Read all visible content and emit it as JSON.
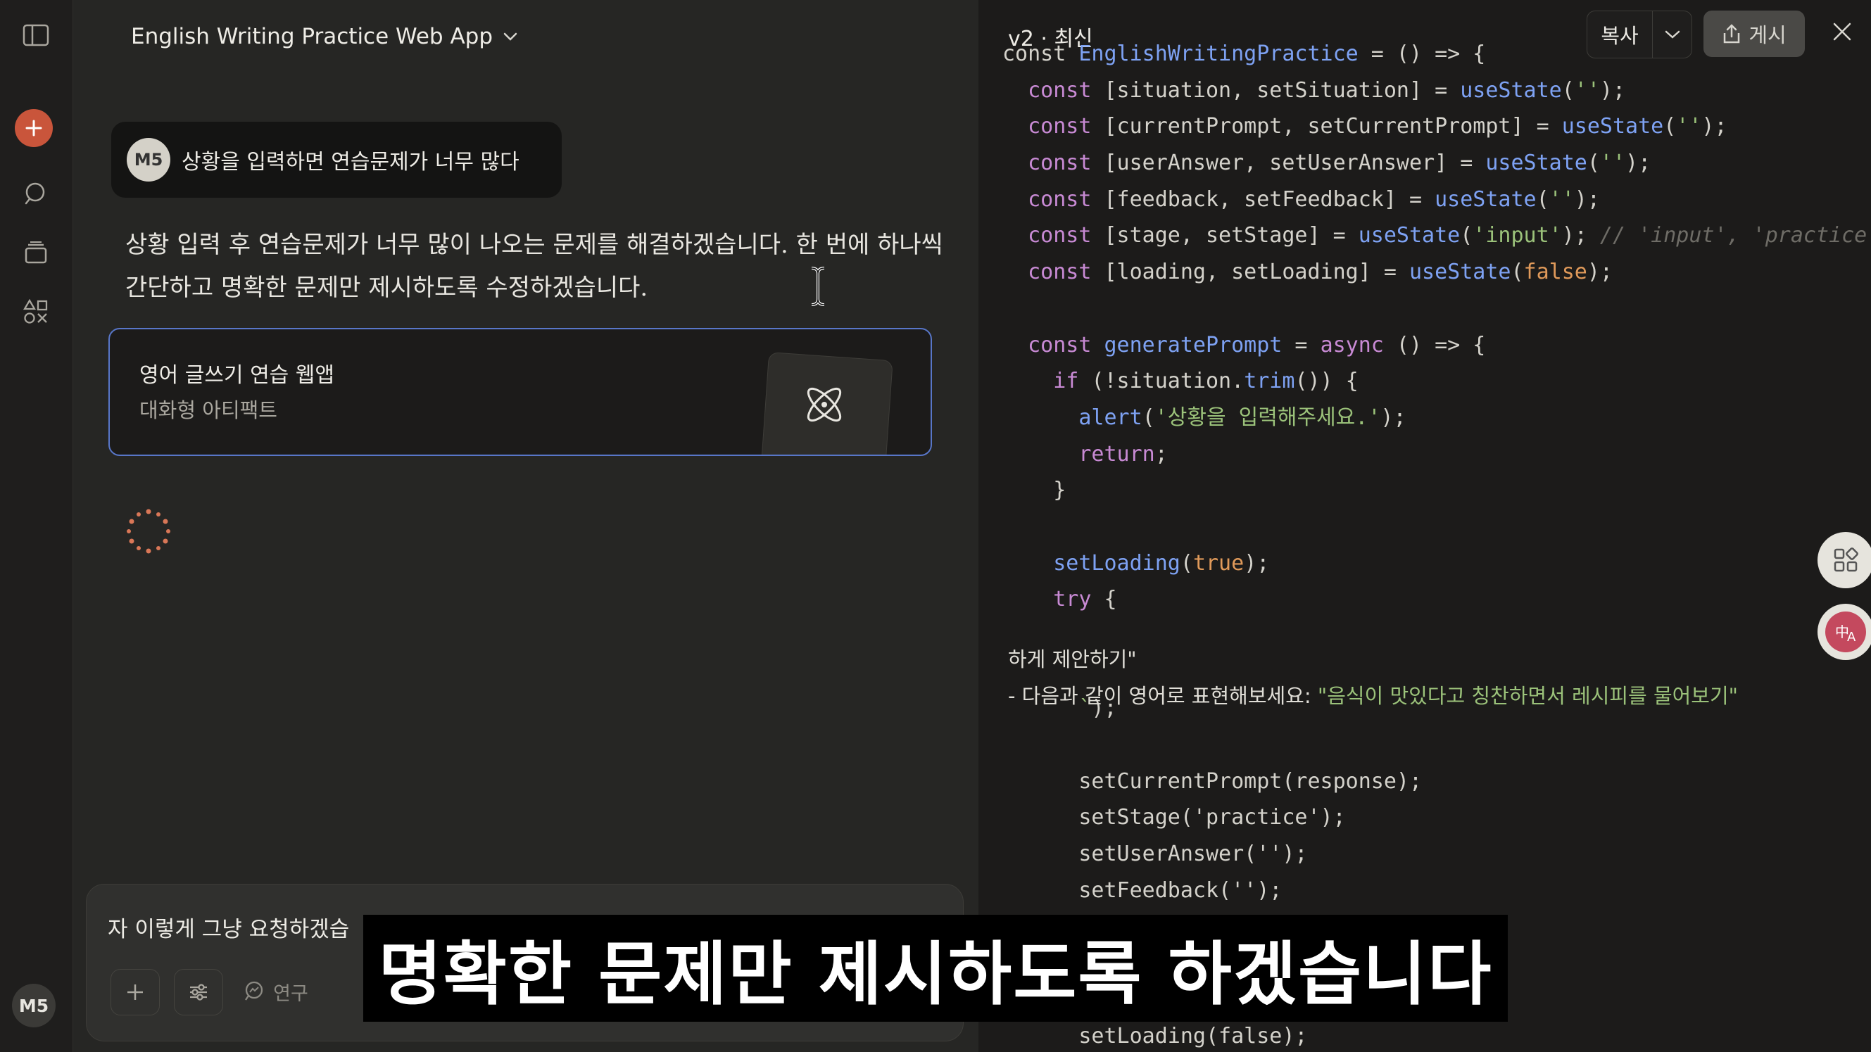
{
  "sidebar": {
    "avatar_initials": "M5",
    "accent_color": "#c9553b"
  },
  "chat": {
    "title": "English Writing Practice Web App",
    "user_message": {
      "avatar_initials": "M5",
      "text": "상황을 입력하면 연습문제가 너무 많다"
    },
    "assistant_text": "상황 입력 후 연습문제가 너무 많이 나오는 문제를 해결하겠습니다. 한 번에 하나씩 간단하고 명확한 문제만 제시하도록 수정하겠습니다.",
    "artifact_card": {
      "title": "영어 글쓰기 연습 웹앱",
      "subtitle": "대화형 아티팩트",
      "icon": "react-icon"
    },
    "composer": {
      "text": "자 이렇게 그냥 요청하겠습",
      "research_label": "연구"
    }
  },
  "artifact_panel": {
    "version_label": "v2 · 최신",
    "copy_label": "복사",
    "publish_label": "게시",
    "code_lines": [
      [
        [
          "v",
          "const "
        ],
        [
          "f",
          "EnglishWritingPractice"
        ],
        [
          "v",
          " = () => {"
        ]
      ],
      [
        [
          "k",
          "  const "
        ],
        [
          "v",
          "[situation, setSituation] = "
        ],
        [
          "f",
          "useState"
        ],
        [
          "v",
          "("
        ],
        [
          "s",
          "''"
        ],
        [
          "v",
          ");"
        ]
      ],
      [
        [
          "k",
          "  const "
        ],
        [
          "v",
          "[currentPrompt, setCurrentPrompt] = "
        ],
        [
          "f",
          "useState"
        ],
        [
          "v",
          "("
        ],
        [
          "s",
          "''"
        ],
        [
          "v",
          ");"
        ]
      ],
      [
        [
          "k",
          "  const "
        ],
        [
          "v",
          "[userAnswer, setUserAnswer] = "
        ],
        [
          "f",
          "useState"
        ],
        [
          "v",
          "("
        ],
        [
          "s",
          "''"
        ],
        [
          "v",
          ");"
        ]
      ],
      [
        [
          "k",
          "  const "
        ],
        [
          "v",
          "[feedback, setFeedback] = "
        ],
        [
          "f",
          "useState"
        ],
        [
          "v",
          "("
        ],
        [
          "s",
          "''"
        ],
        [
          "v",
          ");"
        ]
      ],
      [
        [
          "k",
          "  const "
        ],
        [
          "v",
          "[stage, setStage] = "
        ],
        [
          "f",
          "useState"
        ],
        [
          "v",
          "("
        ],
        [
          "s",
          "'input'"
        ],
        [
          "v",
          "); "
        ],
        [
          "c",
          "// 'input', 'practice'"
        ]
      ],
      [
        [
          "k",
          "  const "
        ],
        [
          "v",
          "[loading, setLoading] = "
        ],
        [
          "f",
          "useState"
        ],
        [
          "v",
          "("
        ],
        [
          "n",
          "false"
        ],
        [
          "v",
          ");"
        ]
      ],
      [
        [
          "v",
          ""
        ]
      ],
      [
        [
          "k",
          "  const "
        ],
        [
          "f",
          "generatePrompt"
        ],
        [
          "v",
          " = "
        ],
        [
          "k",
          "async"
        ],
        [
          "v",
          " () => {"
        ]
      ],
      [
        [
          "k",
          "    if "
        ],
        [
          "v",
          "(!situation."
        ],
        [
          "f",
          "trim"
        ],
        [
          "v",
          "()) {"
        ]
      ],
      [
        [
          "f",
          "      alert"
        ],
        [
          "v",
          "("
        ],
        [
          "s",
          "'상황을 입력해주세요.'"
        ],
        [
          "v",
          ");"
        ]
      ],
      [
        [
          "k",
          "      return"
        ],
        [
          "v",
          ";"
        ]
      ],
      [
        [
          "v",
          "    }"
        ]
      ],
      [
        [
          "v",
          ""
        ]
      ],
      [
        [
          "f",
          "    setLoading"
        ],
        [
          "v",
          "("
        ],
        [
          "n",
          "true"
        ],
        [
          "v",
          ");"
        ]
      ],
      [
        [
          "k",
          "    try"
        ],
        [
          "v",
          " {"
        ]
      ],
      [
        [
          "v",
          ""
        ]
      ],
      [
        [
          "v",
          ""
        ]
      ],
      [
        [
          "s",
          "      `"
        ],
        [
          "v",
          ");"
        ]
      ],
      [
        [
          "v",
          ""
        ]
      ],
      [
        [
          "v",
          "      setCurrentPrompt(response);"
        ]
      ],
      [
        [
          "v",
          "      setStage('practice');"
        ]
      ],
      [
        [
          "v",
          "      setUserAnswer('');"
        ]
      ],
      [
        [
          "v",
          "      setFeedback('');"
        ]
      ],
      [
        [
          "v",
          "    "
        ]
      ],
      [
        [
          "v",
          "                                  '.');"
        ]
      ],
      [
        [
          "v",
          "    }"
        ]
      ],
      [
        [
          "v",
          "      setLoading(false);"
        ]
      ]
    ],
    "overlay_line_1": "하게 제안하기\"",
    "overlay_line_2_prefix": "- 다음과 같이 영어로 표현해보세요: ",
    "overlay_line_2_quote": "\"음식이 맛있다고 칭찬하면서 레시피를 물어보기\""
  },
  "subtitle": {
    "text": "명확한 문제만 제시하도록 하겠습니다"
  }
}
